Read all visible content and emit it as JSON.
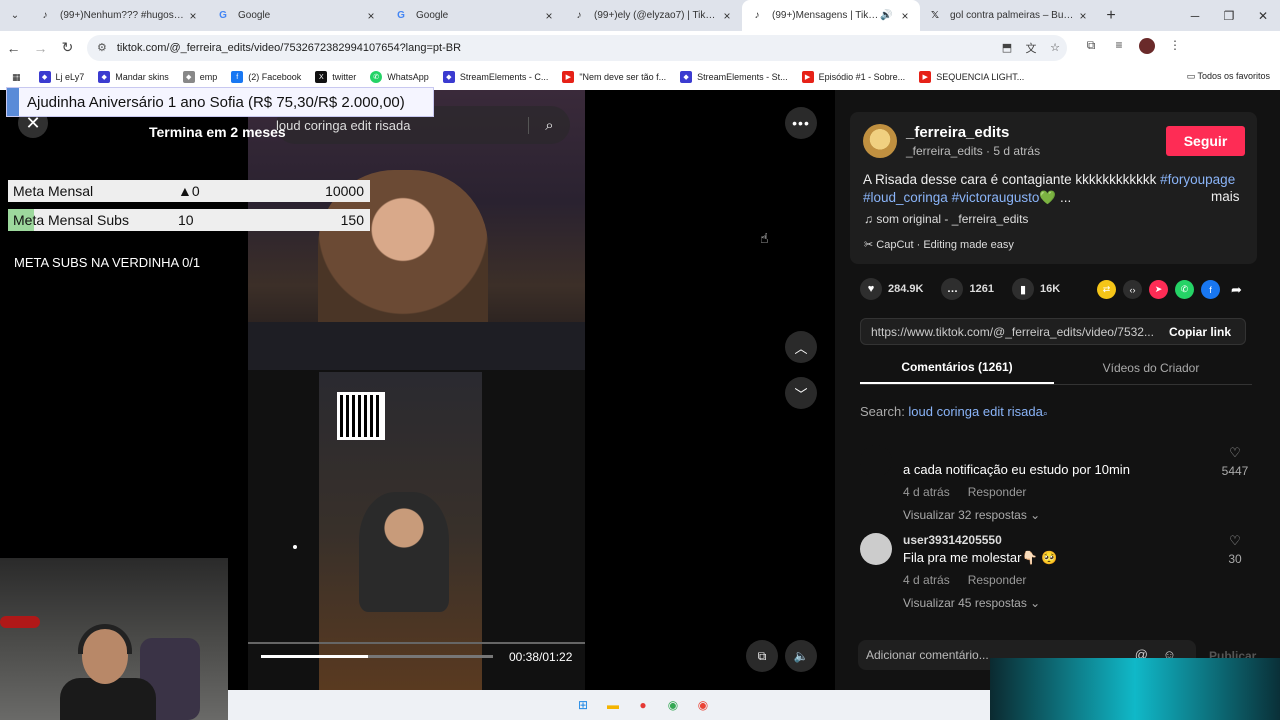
{
  "tabs": [
    {
      "label": "(99+)Nenhum??? #hugosouza",
      "icon": "tiktok-icon"
    },
    {
      "label": "Google",
      "icon": "google-icon"
    },
    {
      "label": "Google",
      "icon": "google-icon"
    },
    {
      "label": "(99+)ely (@elyzao7) | TikTok",
      "icon": "tiktok-icon"
    },
    {
      "label": "(99+)Mensagens | TikTok",
      "icon": "tiktok-icon",
      "active": true
    },
    {
      "label": "gol contra palmeiras – Buscar",
      "icon": "x-icon"
    }
  ],
  "address": {
    "url": "tiktok.com/@_ferreira_edits/video/7532672382994107654?lang=pt-BR"
  },
  "bookmarks": [
    {
      "label": "Lj eLy7",
      "color": "#3b3bd0"
    },
    {
      "label": "Mandar skins",
      "color": "#3b3bd0"
    },
    {
      "label": "emp",
      "color": "#888888"
    },
    {
      "label": "(2) Facebook",
      "color": "#1877f2"
    },
    {
      "label": "twitter",
      "color": "#111111"
    },
    {
      "label": "WhatsApp",
      "color": "#25d366"
    },
    {
      "label": "StreamElements - C...",
      "color": "#3b3bd0"
    },
    {
      "label": "\"Nem deve ser tão f...",
      "color": "#e62117"
    },
    {
      "label": "StreamElements - St...",
      "color": "#3b3bd0"
    },
    {
      "label": "Episódio #1 - Sobre...",
      "color": "#e62117"
    },
    {
      "label": "SEQUENCIA LIGHT...",
      "color": "#e62117"
    }
  ],
  "bookmarks_all": "Todos os favoritos",
  "overlay": {
    "donation": "Ajudinha Aniversário 1 ano Sofia (R$ 75,30/R$ 2.000,00)",
    "ends": "Termina em 2 meses",
    "goals": [
      {
        "name": "Meta Mensal",
        "current": "▲0",
        "max": "10000"
      },
      {
        "name": "Meta Mensal Subs",
        "current": "10",
        "max": "150"
      }
    ],
    "meta_subs": "META SUBS NA VERDINHA 0/1"
  },
  "video": {
    "search_text": "loud coringa edit risada",
    "time": "00:38/01:22",
    "progress": 0.46
  },
  "author": {
    "name": "_ferreira_edits",
    "handle": "_ferreira_edits",
    "date": "5 d atrás",
    "follow": "Seguir"
  },
  "description": {
    "text": "A Risada desse cara é contagiante kkkkkkkkkkkk ",
    "tag1": "#foryoupage",
    "tag2": "#loud_coringa",
    "tag3": "#victoraugusto",
    "suffix": "💚 ...",
    "more": "mais"
  },
  "music": "♫  som original - _ferreira_edits",
  "capcut": "✂  CapCut · Editing made easy",
  "stats": {
    "likes": "284.9K",
    "comments": "1261",
    "saves": "16K"
  },
  "link": {
    "url": "https://www.tiktok.com/@_ferreira_edits/video/7532...",
    "copy": "Copiar link"
  },
  "panel_tabs": {
    "comments": "Comentários (1261)",
    "creator": "Vídeos do Criador"
  },
  "search_line": {
    "label": "Search: ",
    "query": "loud coringa edit risada"
  },
  "comments": [
    {
      "user": "",
      "text": "a cada notificação eu estudo por 10min",
      "date": "4 d atrás",
      "reply": "Responder",
      "replies": "Visualizar 32 respostas ⌄",
      "likes": "5447"
    },
    {
      "user": "user39314205550",
      "text": "Fila pra me molestar👇🏻 🥺",
      "date": "4 d atrás",
      "reply": "Responder",
      "replies": "Visualizar 45 respostas ⌄",
      "likes": "30"
    }
  ],
  "add_comment": {
    "placeholder": "Adicionar comentário...",
    "publish": "Publicar"
  }
}
